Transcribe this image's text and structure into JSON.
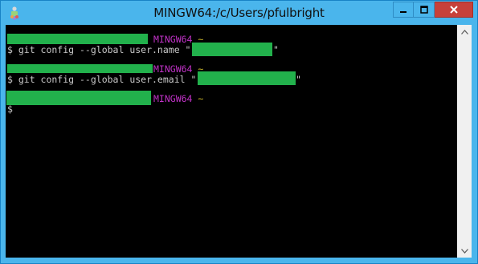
{
  "window": {
    "title": "MINGW64:/c/Users/pfulbright",
    "controls": {
      "minimize_icon": "minimize-icon",
      "maximize_icon": "maximize-icon",
      "close_icon": "close-icon"
    },
    "colors": {
      "titlebar": "#4ab5ec",
      "close": "#c7413a",
      "terminal_bg": "#000000",
      "redaction": "#22b14c"
    }
  },
  "terminal": {
    "prompt_label": "MINGW64",
    "prompt_path": "~",
    "commands": [
      {
        "prefix": "$ git config --global user.name \"",
        "suffix": "\""
      },
      {
        "prefix": "$ git config --global user.email \"",
        "suffix": "\""
      }
    ],
    "current_prompt": "$"
  },
  "scrollbar": {
    "up_icon": "arrow-up-icon",
    "down_icon": "arrow-down-icon"
  }
}
